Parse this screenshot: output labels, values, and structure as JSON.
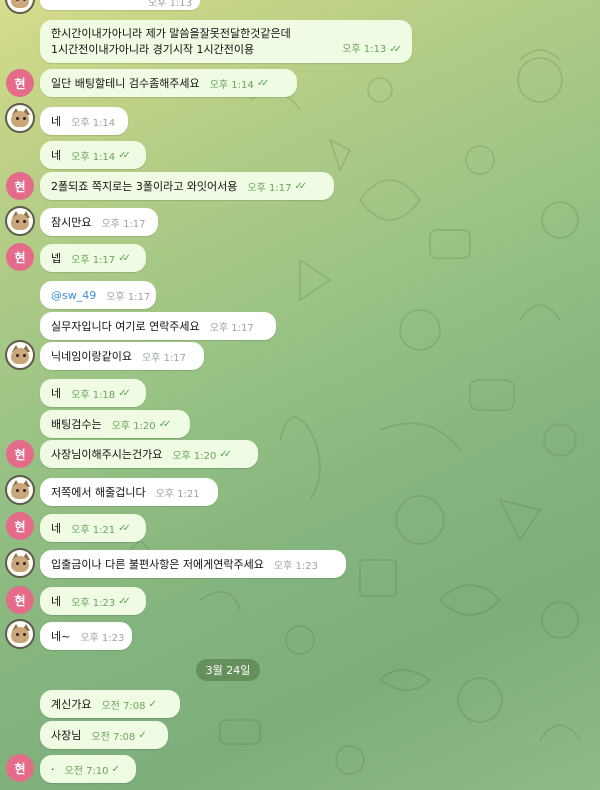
{
  "date_separator": "3월 24일",
  "avatar_initial": "현",
  "messages": [
    {
      "text": "",
      "time": "오후 1:13",
      "read": false,
      "style": "in"
    },
    {
      "text": "한시간이내가아니라 제가 말씀을잘못전달한것같은데",
      "text2": "1시간전이내가아니라 경기시작 1시간전이용",
      "time": "오후 1:13",
      "read": true,
      "style": "out"
    },
    {
      "text": "일단 배팅할테니 검수좀해주세요",
      "time": "오후 1:14",
      "read": true,
      "style": "out"
    },
    {
      "text": "네",
      "time": "오후 1:14",
      "read": false,
      "style": "in"
    },
    {
      "text": "네",
      "time": "오후 1:14",
      "read": true,
      "style": "out"
    },
    {
      "text": "2폴되죠 쪽지로는 3폴이라고 와잇어서용",
      "time": "오후 1:17",
      "read": true,
      "style": "out"
    },
    {
      "text": "잠시만요",
      "time": "오후 1:17",
      "read": false,
      "style": "in"
    },
    {
      "text": "넵",
      "time": "오후 1:17",
      "read": true,
      "style": "out"
    },
    {
      "text": "@sw_49",
      "time": "오후 1:17",
      "read": false,
      "style": "in"
    },
    {
      "text": "실무자입니다 여기로 연락주세요",
      "time": "오후 1:17",
      "read": false,
      "style": "in"
    },
    {
      "text": "닉네임이랑같이요",
      "time": "오후 1:17",
      "read": false,
      "style": "in"
    },
    {
      "text": "네",
      "time": "오후 1:18",
      "read": true,
      "style": "out"
    },
    {
      "text": "배팅검수는",
      "time": "오후 1:20",
      "read": true,
      "style": "out"
    },
    {
      "text": "사장님이해주시는건가요",
      "time": "오후 1:20",
      "read": true,
      "style": "out"
    },
    {
      "text": "저쪽에서 해줄겁니다",
      "time": "오후 1:21",
      "read": false,
      "style": "in"
    },
    {
      "text": "네",
      "time": "오후 1:21",
      "read": true,
      "style": "out"
    },
    {
      "text": "입출금이나 다른 불편사항은 저에게연락주세요",
      "time": "오후 1:23",
      "read": false,
      "style": "in"
    },
    {
      "text": "네",
      "time": "오후 1:23",
      "read": true,
      "style": "out"
    },
    {
      "text": "네~",
      "time": "오후 1:23",
      "read": false,
      "style": "in"
    },
    {
      "text": "계신가요",
      "time": "오전 7:08",
      "read": true,
      "style": "out"
    },
    {
      "text": "사장님",
      "time": "오전 7:08",
      "read": true,
      "style": "out"
    },
    {
      "text": "·",
      "time": "오전 7:10",
      "read": true,
      "style": "out"
    }
  ]
}
